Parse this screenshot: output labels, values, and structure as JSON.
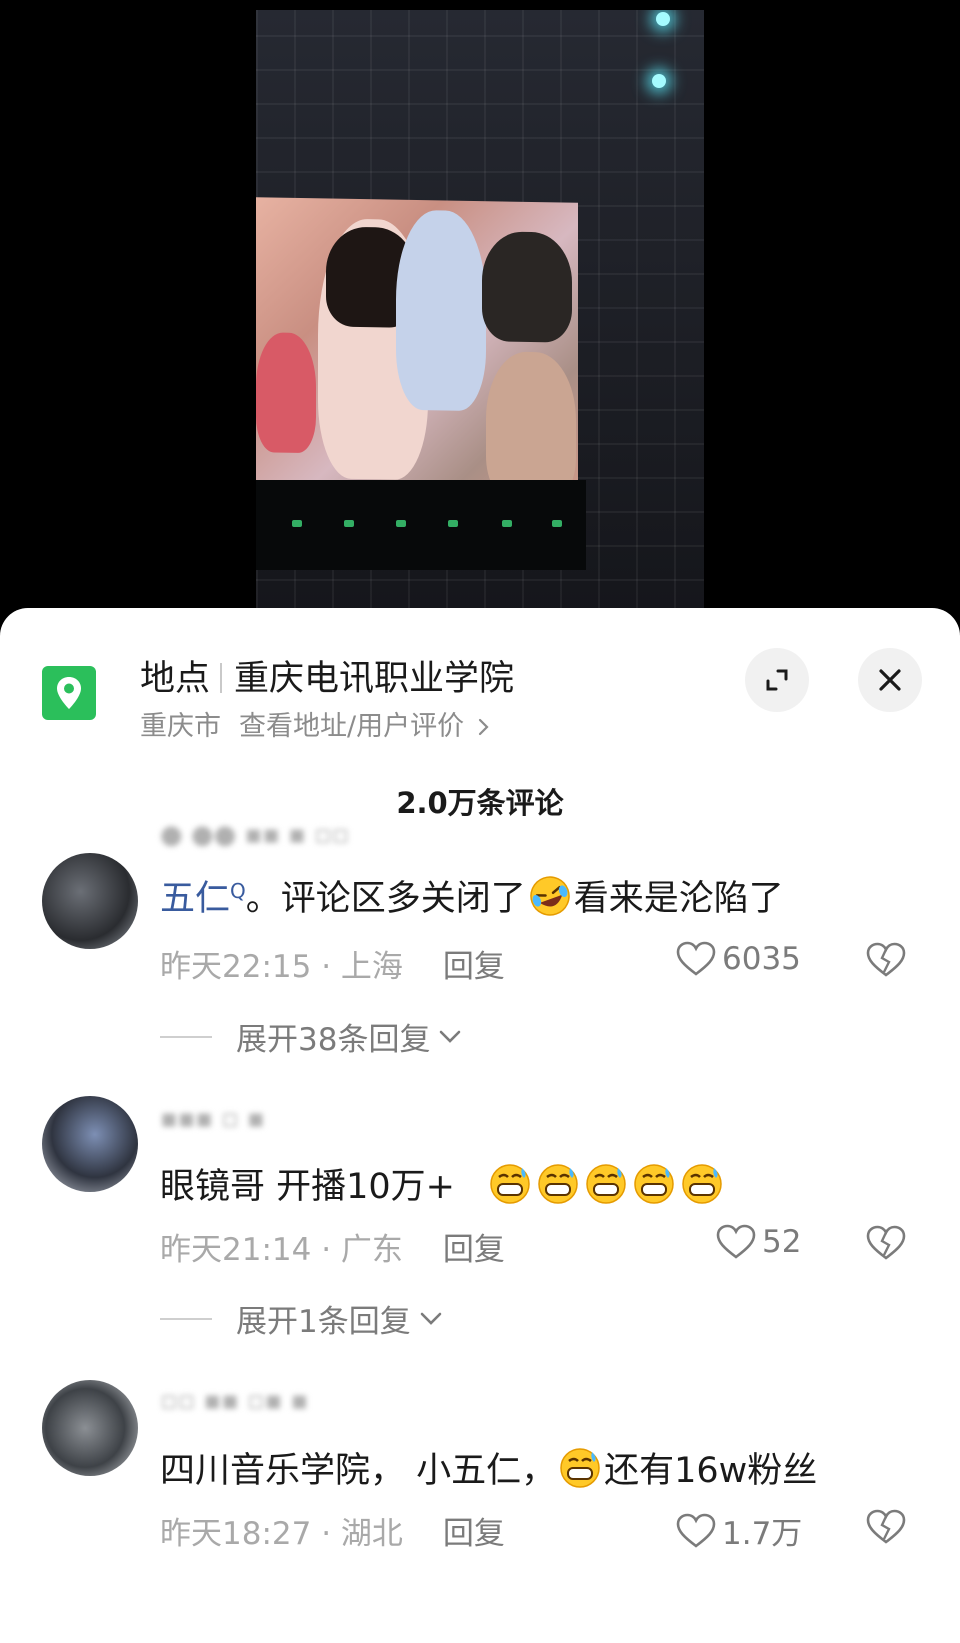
{
  "location": {
    "label": "地点",
    "name": "重庆电讯职业学院",
    "city": "重庆市",
    "link": "查看地址/用户评价",
    "link_icon": "chevron-right-icon",
    "brand_color": "#2bbf5b"
  },
  "comments_count": "2.0万条评论",
  "comments": [
    {
      "mention": "五仁",
      "text_before_emoji": "。评论区多关闭了",
      "emoji": "rolling-on-floor-laughing",
      "text_after_emoji": "看来是沦陷了",
      "time": "昨天22:15",
      "region": "上海",
      "reply_label": "回复",
      "likes": "6035",
      "expand_label": "展开38条回复"
    },
    {
      "text": "眼镜哥 开播10万+",
      "emoji": "grinning-sweat",
      "emoji_count": 5,
      "time": "昨天21:14",
      "region": "广东",
      "reply_label": "回复",
      "likes": "52",
      "expand_label": "展开1条回复"
    },
    {
      "text_before_emoji": "四川音乐学院， 小五仁，",
      "emoji": "grinning-sweat",
      "text_after_emoji": "还有16w粉丝",
      "time": "昨天18:27",
      "region": "湖北",
      "reply_label": "回复",
      "likes": "1.7万"
    }
  ]
}
